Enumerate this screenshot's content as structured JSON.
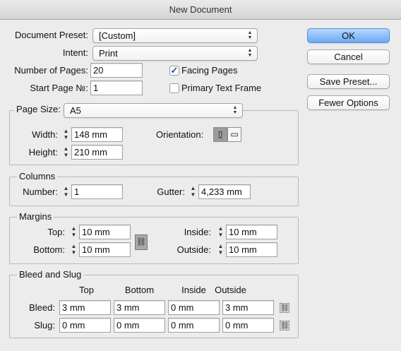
{
  "window": {
    "title": "New Document"
  },
  "preset": {
    "label": "Document Preset:",
    "value": "[Custom]"
  },
  "intent": {
    "label": "Intent:",
    "value": "Print"
  },
  "pages": {
    "label": "Number of Pages:",
    "value": "20"
  },
  "start_page": {
    "label": "Start Page №:",
    "value": "1"
  },
  "facing_pages": {
    "label": "Facing Pages",
    "checked": true
  },
  "primary_text_frame": {
    "label": "Primary Text Frame",
    "checked": false
  },
  "buttons": {
    "ok": "OK",
    "cancel": "Cancel",
    "save_preset": "Save Preset...",
    "fewer_options": "Fewer Options"
  },
  "page_size": {
    "label": "Page Size:",
    "value": "A5",
    "width_label": "Width:",
    "width": "148 mm",
    "height_label": "Height:",
    "height": "210 mm",
    "orientation_label": "Orientation:"
  },
  "columns": {
    "title": "Columns",
    "number_label": "Number:",
    "number": "1",
    "gutter_label": "Gutter:",
    "gutter": "4,233 mm"
  },
  "margins": {
    "title": "Margins",
    "top_label": "Top:",
    "top": "10 mm",
    "bottom_label": "Bottom:",
    "bottom": "10 mm",
    "inside_label": "Inside:",
    "inside": "10 mm",
    "outside_label": "Outside:",
    "outside": "10 mm"
  },
  "bleed_slug": {
    "title": "Bleed and Slug",
    "headers": [
      "Top",
      "Bottom",
      "Inside",
      "Outside"
    ],
    "bleed_label": "Bleed:",
    "bleed": [
      "3 mm",
      "3 mm",
      "0 mm",
      "3 mm"
    ],
    "slug_label": "Slug:",
    "slug": [
      "0 mm",
      "0 mm",
      "0 mm",
      "0 mm"
    ]
  },
  "icons": {
    "stepper": "stepper-arrows-icon",
    "popup": "popup-arrows-icon",
    "orientation_portrait": "portrait-page-icon",
    "orientation_landscape": "landscape-page-icon",
    "link": "chain-link-icon"
  }
}
